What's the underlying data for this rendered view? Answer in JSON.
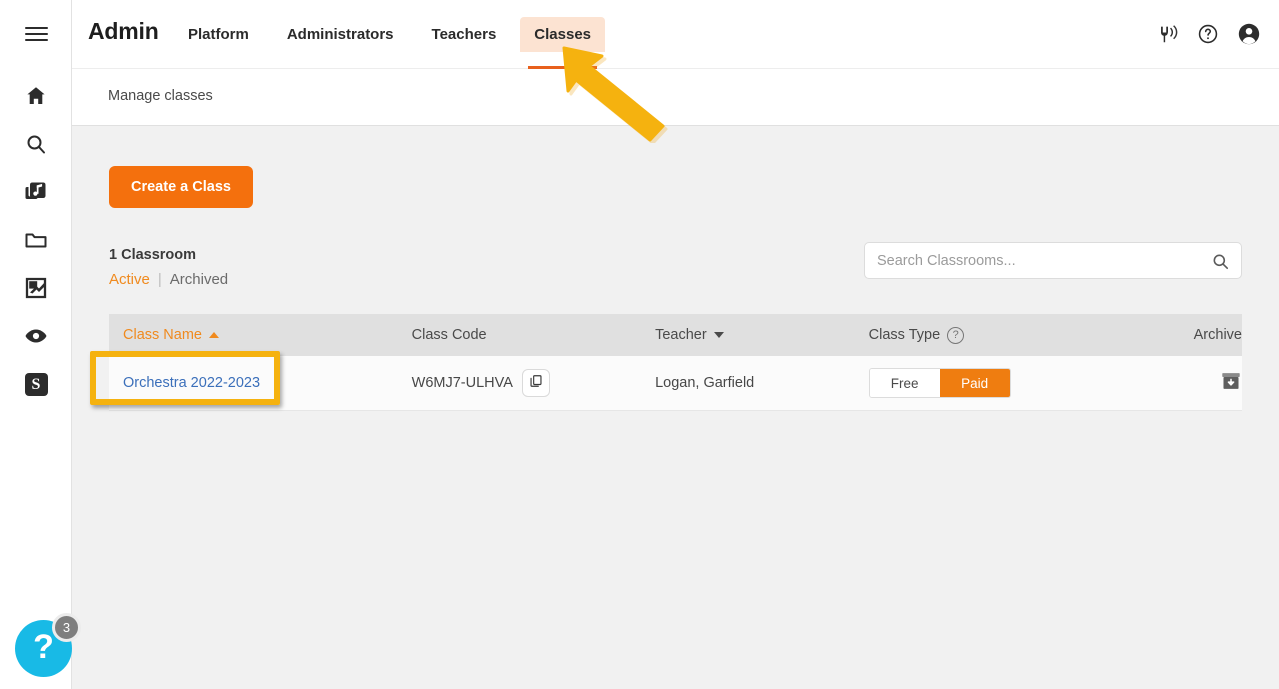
{
  "topbar": {
    "brand": "Admin",
    "menu_icon": "hamburger-icon",
    "tabs": [
      {
        "label": "Platform",
        "active": false
      },
      {
        "label": "Administrators",
        "active": false
      },
      {
        "label": "Teachers",
        "active": false
      },
      {
        "label": "Classes",
        "active": true
      }
    ],
    "icons": [
      {
        "name": "tuning-fork-icon"
      },
      {
        "name": "help-circle-icon"
      },
      {
        "name": "account-avatar-icon"
      }
    ]
  },
  "sidebar": {
    "items": [
      {
        "name": "home-icon",
        "label": "Home"
      },
      {
        "name": "search-icon",
        "label": "Search"
      },
      {
        "name": "music-library-icon",
        "label": "Library"
      },
      {
        "name": "folder-icon",
        "label": "Folders"
      },
      {
        "name": "assignment-icon",
        "label": "Assignments"
      },
      {
        "name": "eye-icon",
        "label": "View"
      },
      {
        "name": "s-logo-icon",
        "label": "S"
      }
    ]
  },
  "subheader": {
    "breadcrumb": "Manage classes"
  },
  "main": {
    "create_button": "Create a Class",
    "count_label": "1 Classroom",
    "filters": [
      {
        "label": "Active",
        "active": true
      },
      {
        "label": "Archived",
        "active": false
      }
    ],
    "filter_separator": "|",
    "search": {
      "placeholder": "Search Classrooms...",
      "value": "",
      "icon": "search-icon"
    }
  },
  "table": {
    "columns": [
      {
        "label": "Class Name",
        "sort": "asc",
        "sorted": true
      },
      {
        "label": "Class Code",
        "sort": "none",
        "sorted": false
      },
      {
        "label": "Teacher",
        "sort": "desc",
        "sorted": false
      },
      {
        "label": "Class Type",
        "sort": "none",
        "sorted": false,
        "help": true
      },
      {
        "label": "Archive",
        "sort": "none",
        "sorted": false
      }
    ],
    "rows": [
      {
        "class_name": "Orchestra 2022-2023",
        "class_code": "W6MJ7-ULHVA",
        "copy_icon": "copy-icon",
        "teacher": "Logan, Garfield",
        "class_type": {
          "free_label": "Free",
          "paid_label": "Paid",
          "selected": "Paid"
        },
        "archive_icon": "archive-icon"
      }
    ]
  },
  "help_fab": {
    "glyph": "?",
    "badge": "3"
  },
  "annotations": {
    "highlight_target": "Orchestra 2022-2023",
    "arrow_target": "Classes"
  },
  "colors": {
    "accent_orange": "#f4700d",
    "tab_highlight_bg": "#fce3d2",
    "tab_underline": "#e8601c",
    "link_blue": "#3b6fba",
    "annotation_yellow": "#f5b20f",
    "fab_cyan": "#18bae6",
    "page_bg": "#f1f1f1"
  }
}
